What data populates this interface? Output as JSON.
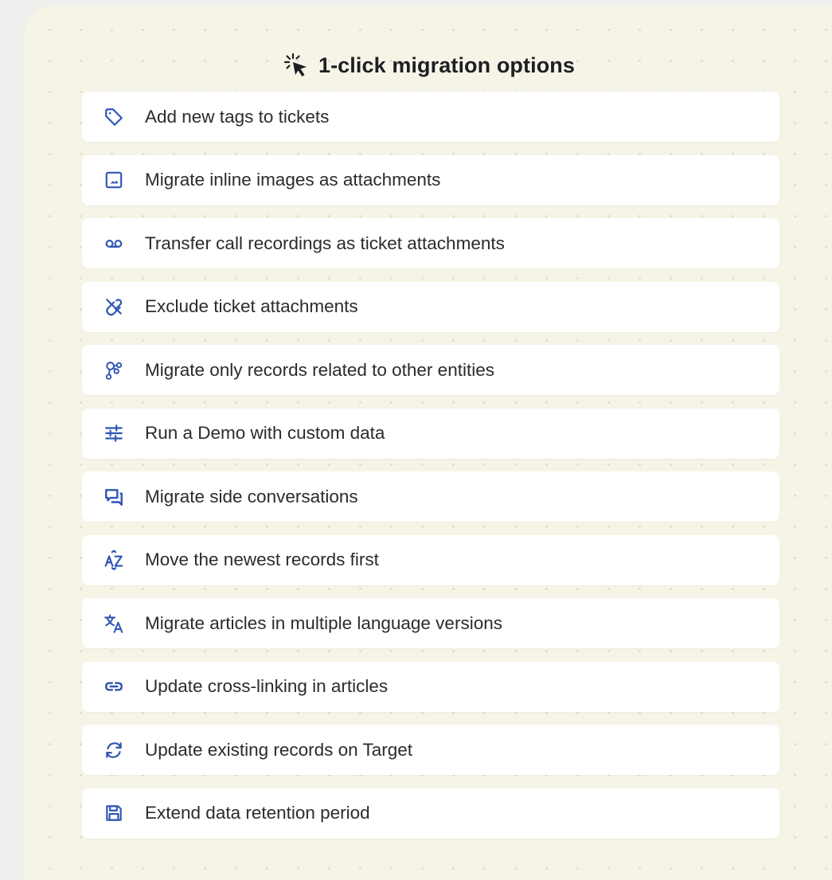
{
  "title": "1-click migration options",
  "title_icon": "sparkle-cursor-icon",
  "accent_color": "#2f55b3",
  "options": [
    {
      "label": "Add new tags to tickets",
      "icon": "tag-icon"
    },
    {
      "label": "Migrate inline images as attachments",
      "icon": "image-icon"
    },
    {
      "label": "Transfer call recordings as ticket attachments",
      "icon": "voicemail-icon"
    },
    {
      "label": "Exclude ticket attachments",
      "icon": "attachment-off-icon"
    },
    {
      "label": "Migrate only records related to other entities",
      "icon": "relations-icon"
    },
    {
      "label": "Run a Demo with custom data",
      "icon": "sliders-icon"
    },
    {
      "label": "Migrate side conversations",
      "icon": "chat-icon"
    },
    {
      "label": "Move the newest records first",
      "icon": "sort-az-icon"
    },
    {
      "label": "Migrate articles in multiple language versions",
      "icon": "translate-icon"
    },
    {
      "label": "Update cross-linking in articles",
      "icon": "link-icon"
    },
    {
      "label": "Update existing records on Target",
      "icon": "refresh-icon"
    },
    {
      "label": "Extend data retention period",
      "icon": "save-icon"
    }
  ]
}
